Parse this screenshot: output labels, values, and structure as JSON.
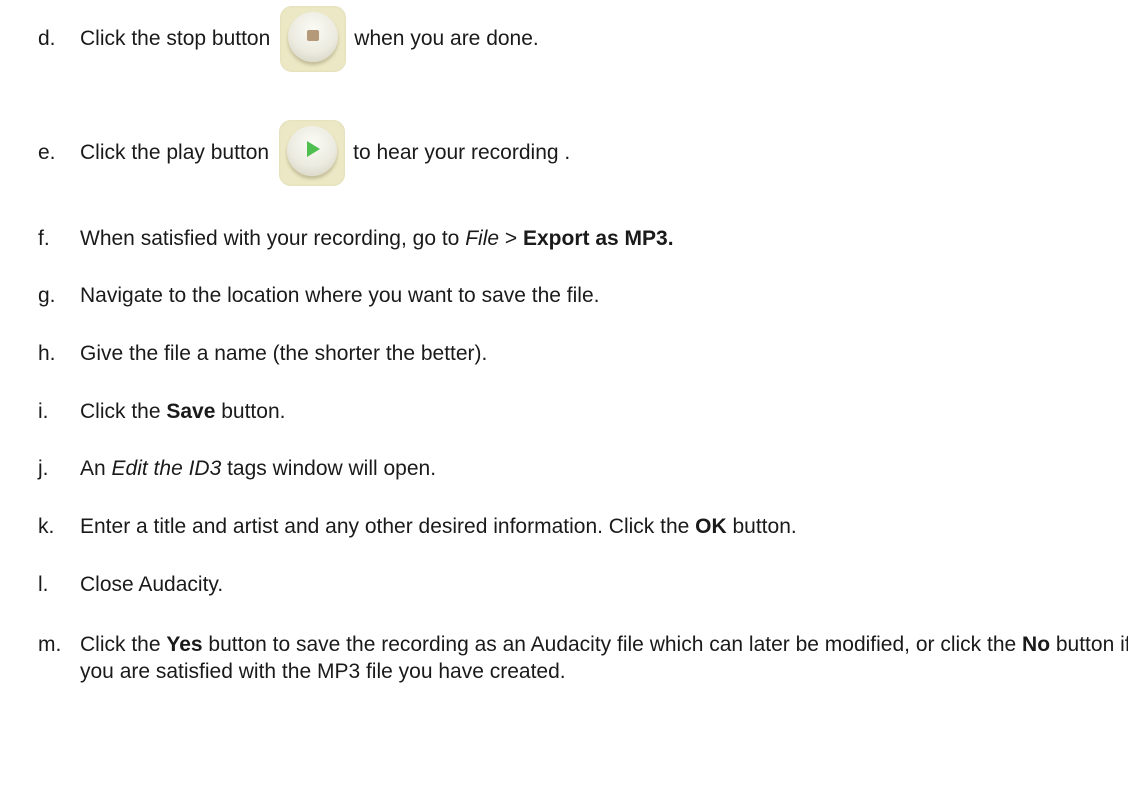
{
  "steps": [
    {
      "letter": "d.",
      "before": "Click the stop button",
      "after": "when you are done.",
      "icon": "stop-icon"
    },
    {
      "letter": "e.",
      "before": "Click the play button",
      "after": "to hear your recording .",
      "icon": "play-icon"
    },
    {
      "letter": "f.",
      "t1": "When satisfied with your recording, go to ",
      "file": "File",
      "t2": " > ",
      "export": "Export as MP3."
    },
    {
      "letter": "g.",
      "text": "Navigate to the location where you want to save the file."
    },
    {
      "letter": "h.",
      "text": "Give the file a name (the shorter the better)."
    },
    {
      "letter": "i.",
      "t1": "Click the ",
      "save": "Save",
      "t2": " button."
    },
    {
      "letter": "j.",
      "t1": "An ",
      "edit": "Edit the ID3",
      "t2": " tags window will open."
    },
    {
      "letter": "k.",
      "t1": "Enter a title and artist and any other desired information. Click the ",
      "ok": "OK",
      "t2": " button."
    },
    {
      "letter": "l.",
      "text": "Close Audacity."
    },
    {
      "letter": "m.",
      "t1": "Click the ",
      "yes": "Yes",
      "t2": " button to save the recording as an Audacity file which can later be modified, or click the ",
      "no": "No",
      "t3": " button if you are satisfied with the MP3 file you have created."
    }
  ]
}
